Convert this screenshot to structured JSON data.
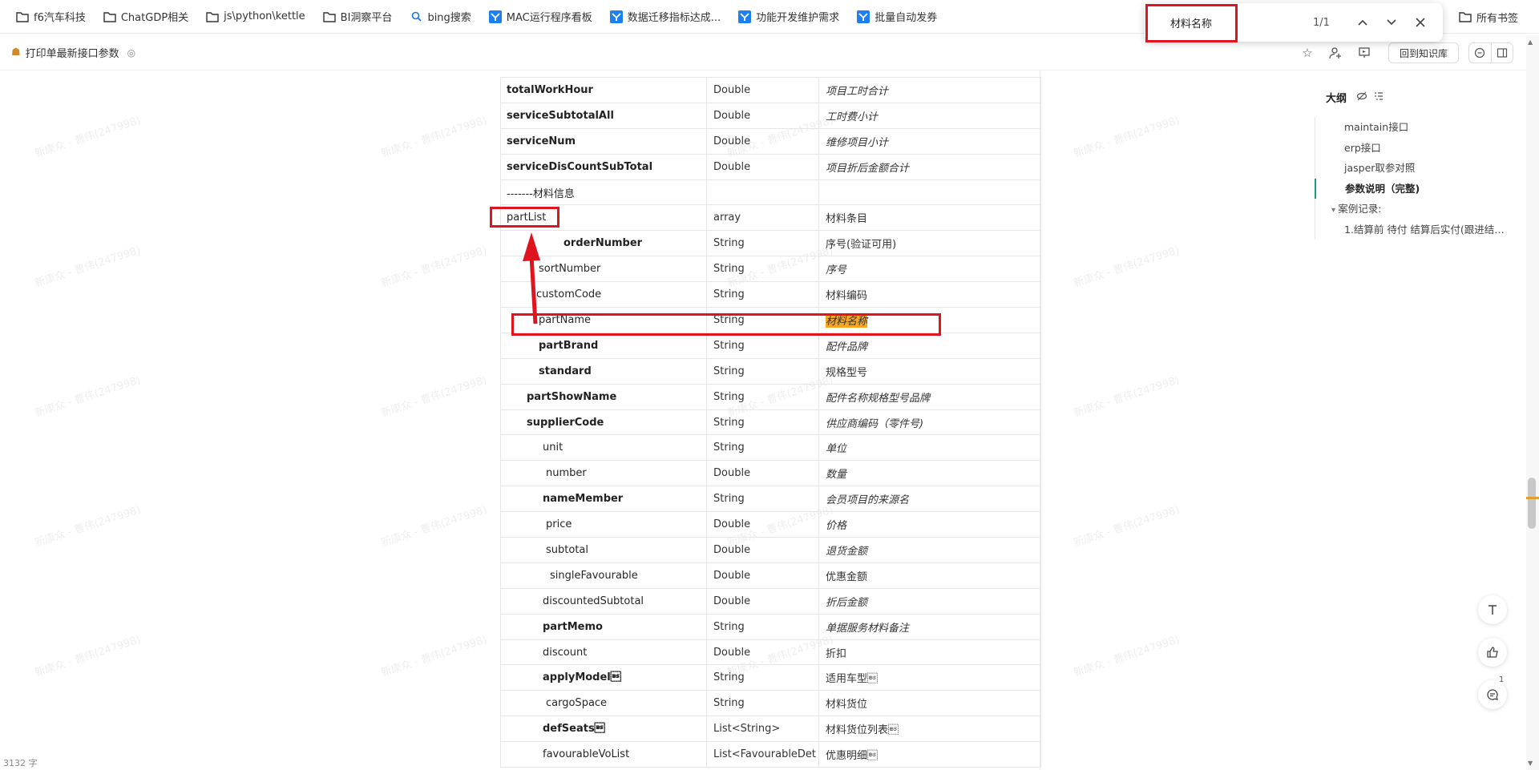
{
  "bookmarks": {
    "items": [
      {
        "label": "f6汽车科技",
        "icon": "folder-icon"
      },
      {
        "label": "ChatGDP相关",
        "icon": "folder-icon"
      },
      {
        "label": "js\\python\\kettle",
        "icon": "folder-icon"
      },
      {
        "label": "BI洞察平台",
        "icon": "folder-icon"
      },
      {
        "label": "bing搜索",
        "icon": "search-icon"
      },
      {
        "label": "MAC运行程序看板",
        "icon": "app-icon"
      },
      {
        "label": "数据迁移指标达成...",
        "icon": "app-icon"
      },
      {
        "label": "功能开发维护需求",
        "icon": "app-icon"
      },
      {
        "label": "批量自动发券",
        "icon": "app-icon"
      }
    ],
    "all_bookmarks": "所有书签"
  },
  "find": {
    "query": "材料名称",
    "count": "1/1"
  },
  "toolbar": {
    "title": "打印单最新接口参数",
    "back_label": "回到知识库"
  },
  "watermark": "新康众 - 曹伟(247998)",
  "table": {
    "rows": [
      {
        "name": "totalWorkHour",
        "type": "Double",
        "desc": "项目工时合计",
        "bold": true,
        "italic": true,
        "indent": 0
      },
      {
        "name": "serviceSubtotalAll",
        "type": "Double",
        "desc": "工时费小计",
        "bold": true,
        "italic": true,
        "indent": 0
      },
      {
        "name": "serviceNum",
        "type": "Double",
        "desc": "维修项目小计",
        "bold": true,
        "italic": true,
        "indent": 0
      },
      {
        "name": "serviceDisCountSubTotal",
        "type": "Double",
        "desc": "项目折后金额合计",
        "bold": true,
        "italic": true,
        "indent": 0
      },
      {
        "name": "-------材料信息",
        "type": "",
        "desc": "",
        "bold": false,
        "italic": false,
        "indent": 0
      },
      {
        "name": "partList",
        "type": "array",
        "desc": "材料条目",
        "bold": false,
        "italic": false,
        "indent": 0
      },
      {
        "name": "orderNumber",
        "type": "String",
        "desc": "序号(验证可用)",
        "bold": true,
        "italic": false,
        "indent": 71
      },
      {
        "name": "sortNumber",
        "type": "String",
        "desc": "序号",
        "bold": false,
        "italic": true,
        "indent": 40
      },
      {
        "name": "customCode",
        "type": "String",
        "desc": "材料编码",
        "bold": false,
        "italic": false,
        "indent": 37
      },
      {
        "name": "partName",
        "type": "String",
        "desc": "材料名称",
        "bold": false,
        "italic": true,
        "indent": 40,
        "highlight": true
      },
      {
        "name": "partBrand",
        "type": "String",
        "desc": "配件品牌",
        "bold": true,
        "italic": true,
        "indent": 40
      },
      {
        "name": "standard",
        "type": "String",
        "desc": "规格型号",
        "bold": true,
        "italic": false,
        "indent": 40
      },
      {
        "name": "partShowName",
        "type": "String",
        "desc": "配件名称规格型号品牌",
        "bold": true,
        "italic": true,
        "indent": 25
      },
      {
        "name": "supplierCode",
        "type": "String",
        "desc": "供应商编码（零件号)",
        "bold": true,
        "italic": true,
        "indent": 25
      },
      {
        "name": "unit",
        "type": "String",
        "desc": "单位",
        "bold": false,
        "italic": true,
        "indent": 45
      },
      {
        "name": "number",
        "type": "Double",
        "desc": "数量",
        "bold": false,
        "italic": true,
        "indent": 49
      },
      {
        "name": "nameMember",
        "type": "String",
        "desc": "会员项目的来源名",
        "bold": true,
        "italic": true,
        "indent": 45
      },
      {
        "name": "price",
        "type": "Double",
        "desc": "价格",
        "bold": false,
        "italic": true,
        "indent": 49
      },
      {
        "name": "subtotal",
        "type": "Double",
        "desc": "退货金额",
        "bold": false,
        "italic": true,
        "indent": 49
      },
      {
        "name": "singleFavourable",
        "type": "Double",
        "desc": "优惠金额",
        "bold": false,
        "italic": false,
        "indent": 54
      },
      {
        "name": "discountedSubtotal",
        "type": "Double",
        "desc": "折后金额",
        "bold": false,
        "italic": true,
        "indent": 45
      },
      {
        "name": "partMemo",
        "type": "String",
        "desc": "单据服务材料备注",
        "bold": true,
        "italic": true,
        "indent": 45
      },
      {
        "name": "discount",
        "type": "Double",
        "desc": "折扣",
        "bold": false,
        "italic": false,
        "indent": 45
      },
      {
        "name": "applyModel\b",
        "type": "String",
        "desc": "适用车型\b",
        "bold": true,
        "italic": false,
        "indent": 45
      },
      {
        "name": "cargoSpace",
        "type": "String",
        "desc": "材料货位",
        "bold": false,
        "italic": false,
        "indent": 49
      },
      {
        "name": "defSeats\b",
        "type": "List<String>",
        "desc": "材料货位列表\b",
        "bold": true,
        "italic": false,
        "indent": 45
      },
      {
        "name": "favourableVoList",
        "type": "List<FavourableDet",
        "desc": "优惠明细\b",
        "bold": false,
        "italic": false,
        "indent": 45
      }
    ]
  },
  "outline": {
    "title": "大纲",
    "items": [
      {
        "label": "maintain接口",
        "indent": 36,
        "active": false,
        "collapsible": false
      },
      {
        "label": "erp接口",
        "indent": 36,
        "active": false,
        "collapsible": false
      },
      {
        "label": "jasper取参对照",
        "indent": 36,
        "active": false,
        "collapsible": false
      },
      {
        "label": "参数说明（完整)",
        "indent": 36,
        "active": true,
        "collapsible": false
      },
      {
        "label": "案例记录:",
        "indent": 20,
        "active": false,
        "collapsible": true
      },
      {
        "label": "1.结算前 待付 结算后实付(跟进结算...",
        "indent": 36,
        "active": false,
        "collapsible": false
      }
    ]
  },
  "comments_badge": "1",
  "word_count": "3132 字"
}
